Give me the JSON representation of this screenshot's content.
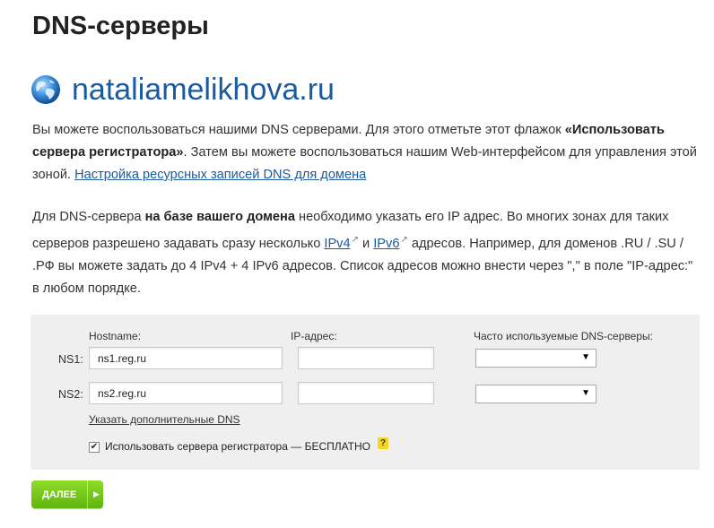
{
  "page": {
    "title": "DNS-серверы"
  },
  "domain": {
    "name": "nataliamelikhova.ru",
    "icon": "globe-icon"
  },
  "intro": {
    "t1": "Вы можете воспользоваться нашими DNS серверами. Для этого отметьте этот флажок ",
    "bold": "«Использовать сервера регистратора»",
    "t2": ". Затем вы можете воспользоваться нашим Web-интерфейсом для управления этой зоной. ",
    "link": "Настройка ресурсных записей DNS для домена"
  },
  "info": {
    "t1": "Для DNS-сервера ",
    "bold": "на базе вашего домена",
    "t2": " необходимо указать его IP адрес. Во многих зонах для таких серверов разрешено задавать сразу несколько ",
    "link1": "IPv4",
    "t3": " и ",
    "link2": "IPv6",
    "t4": " адресов. Например, для доменов .RU / .SU / .РФ вы можете задать до 4 IPv4 + 4 IPv6 адресов. Список адресов можно внести через \",\" в поле \"IP-адрес:\" в любом порядке."
  },
  "form": {
    "col_hostname": "Hostname:",
    "col_ip": "IP-адрес:",
    "col_common": "Часто используемые DNS-серверы:",
    "rows": [
      {
        "label": "NS1:",
        "hostname": "ns1.reg.ru",
        "ip": "",
        "select": ""
      },
      {
        "label": "NS2:",
        "hostname": "ns2.reg.ru",
        "ip": "",
        "select": ""
      }
    ],
    "more_link": "Указать дополнительные DNS",
    "use_registrar_label": "Использовать сервера регистратора — БЕСПЛАТНО",
    "use_registrar_checked": true,
    "help": "?"
  },
  "next_button": {
    "label": "ДАЛЕЕ",
    "color": "#6cc214"
  }
}
